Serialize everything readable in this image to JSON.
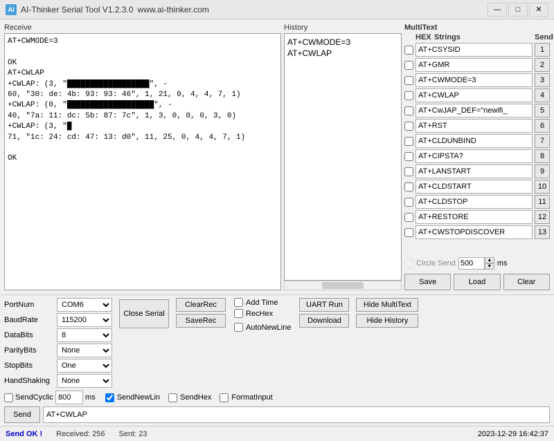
{
  "titleBar": {
    "appName": "AI-Thinker Serial Tool V1.2.3.0",
    "website": "www.ai-thinker.com",
    "minBtn": "—",
    "maxBtn": "□",
    "closeBtn": "✕"
  },
  "receive": {
    "label": "Receive",
    "content": "AT+CWMODE=3\r\n\r\nOK\r\nAT+CWLAP\r\n+CWLAP: (3, \"████████████████\", -\r\n60, \"30: de: 4b: 93: 93: 46\", 1, 21, 0, 4, 4, 7, 1)\r\n+CWLAP: (0, \"█████████████████\", -\r\n40, \"7a: 11: dc: 5b: 87: 7c\", 1, 3, 0, 0, 0, 3, 0)\r\n+CWLAP: (3, \"█\r\n71, \"1c: 24: cd: 47: 13: d0\", 11, 25, 0, 4, 4, 7, 1)\r\n\r\nOK"
  },
  "history": {
    "label": "History",
    "items": [
      "AT+CWMODE=3",
      "AT+CWLAP"
    ]
  },
  "multiText": {
    "label": "MultiText",
    "hexLabel": "HEX",
    "stringsLabel": "Strings",
    "sendLabel": "Send",
    "rows": [
      {
        "checked": false,
        "value": "AT+CSYSID",
        "sendNum": "1"
      },
      {
        "checked": false,
        "value": "AT+GMR",
        "sendNum": "2"
      },
      {
        "checked": false,
        "value": "AT+CWMODE=3",
        "sendNum": "3"
      },
      {
        "checked": false,
        "value": "AT+CWLAP",
        "sendNum": "4"
      },
      {
        "checked": false,
        "value": "AT+CwJAP_DEF=\"newifi_",
        "sendNum": "5"
      },
      {
        "checked": false,
        "value": "AT+RST",
        "sendNum": "6"
      },
      {
        "checked": false,
        "value": "AT+CLDUNBIND",
        "sendNum": "7"
      },
      {
        "checked": false,
        "value": "AT+CIPSTA?",
        "sendNum": "8"
      },
      {
        "checked": false,
        "value": "AT+LANSTART",
        "sendNum": "9"
      },
      {
        "checked": false,
        "value": "AT+CLDSTART",
        "sendNum": "10"
      },
      {
        "checked": false,
        "value": "AT+CLDSTOP",
        "sendNum": "11"
      },
      {
        "checked": false,
        "value": "AT+RESTORE",
        "sendNum": "12"
      },
      {
        "checked": false,
        "value": "AT+CWSTOPDISCOVER",
        "sendNum": "13"
      }
    ],
    "circleSend": {
      "label": "Circle Send",
      "value": "500",
      "unit": "ms"
    },
    "saveBtn": "Save",
    "loadBtn": "Load",
    "clearBtn": "Clear"
  },
  "bottomControls": {
    "portNum": {
      "label": "PortNum",
      "value": "COM6"
    },
    "baudRate": {
      "label": "BaudRate",
      "value": "115200"
    },
    "dataBits": {
      "label": "DataBits",
      "value": "8"
    },
    "parityBits": {
      "label": "ParityBits",
      "value": "None"
    },
    "stopBits": {
      "label": "StopBits",
      "value": "One"
    },
    "handShaking": {
      "label": "HandShaking",
      "value": "None"
    },
    "closeSerialBtn": "Close Serial",
    "clearRecBtn": "ClearRec",
    "saveRecBtn": "SaveRec",
    "addTime": {
      "label": "Add Time",
      "checked": false
    },
    "recHex": {
      "label": "RecHex",
      "checked": false
    },
    "autoNewLine": {
      "label": "AutoNewLine",
      "checked": false
    },
    "uartRunBtn": "UART Run",
    "downloadBtn": "Download",
    "hideMultiTextBtn": "Hide MultiText",
    "hideHistoryBtn": "Hide History",
    "sendCyclic": {
      "label": "SendCyclic",
      "checked": false,
      "value": "800",
      "unit": "ms"
    },
    "sendNewLine": {
      "label": "SendNewLin",
      "checked": true
    },
    "sendHex": {
      "label": "SendHex",
      "checked": false
    },
    "formatInput": {
      "label": "FormatInput",
      "checked": false
    },
    "sendBtn": "Send",
    "sendInput": "AT+CWLAP"
  },
  "statusBar": {
    "sendOk": "Send OK !",
    "received": "Received: 256",
    "sent": "Sent: 23",
    "datetime": "2023-12-29 16:42:37"
  }
}
